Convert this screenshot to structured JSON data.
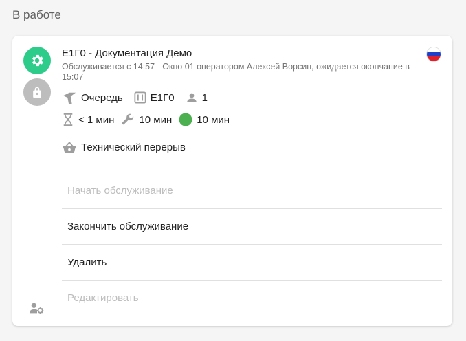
{
  "section": {
    "title": "В работе"
  },
  "ticket": {
    "title": "Е1Г0 - Документация Демо",
    "subtitle": "Обслуживается с 14:57 - Окно 01 оператором Алексей Ворсин, ожидается окончание в 15:07",
    "flag": "ru-flag"
  },
  "info": {
    "queue_label": "Очередь",
    "ticket_code": "Е1Г0",
    "persons": "1",
    "wait_time": "< 1 мин",
    "service_time": "10 мин",
    "status_time": "10 мин",
    "status_color": "#4caf50",
    "break_label": "Технический перерыв"
  },
  "menu": {
    "start": "Начать обслуживание",
    "finish": "Закончить обслуживание",
    "delete": "Удалить",
    "edit": "Редактировать"
  },
  "colors": {
    "accent": "#2ecc8a",
    "muted": "#bdbdbd"
  }
}
